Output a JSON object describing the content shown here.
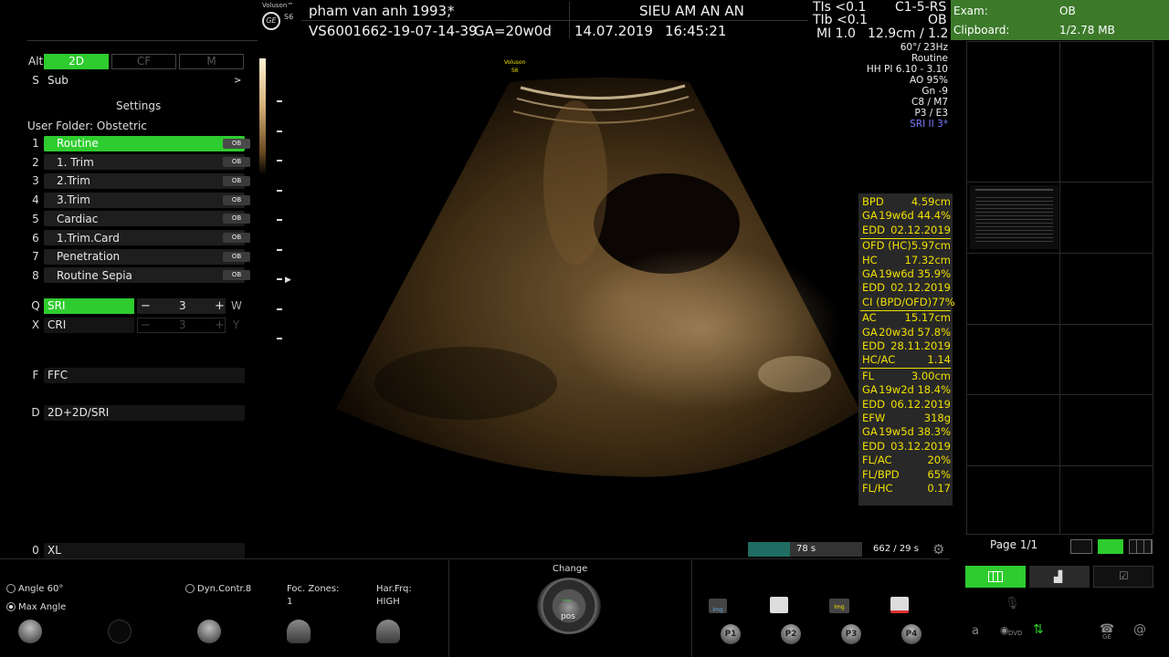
{
  "header": {
    "logo_brand": "Voluson™",
    "logo_model": "S6",
    "logo_maker": "GE",
    "patient": "pham van anh 1993,",
    "patient_flag": "*",
    "clinic": "SIEU AM AN AN",
    "exam_id": "VS6001662-19-07-14-39",
    "ga": "GA=20w0d",
    "date": "14.07.2019",
    "time": "16:45:21",
    "tis": "TIs <0.1",
    "tib": "TIb <0.1",
    "mi": "MI  1.0",
    "probe": "C1-5-RS",
    "preset": "OB",
    "depth": "12.9cm / 1.2"
  },
  "image_params": [
    "60°/ 23Hz",
    "Routine",
    "HH PI 6.10 - 3.10",
    "AO 95%",
    "Gn  -9",
    "C8 / M7",
    "P3 / E3",
    "SRI II 3*"
  ],
  "image_params_accent": "#7b7bff",
  "scan_watermark": {
    "brand": "Voluson",
    "model": "S6"
  },
  "right_bar": {
    "exam_label": "Exam:",
    "exam_value": "OB",
    "clipboard_label": "Clipboard:",
    "clipboard_value": "1/2.78 MB",
    "color": "#3c7a2a"
  },
  "left_panel": {
    "alt": "Alt",
    "mode_2d": "2D",
    "mode_cf": "CF",
    "mode_m": "M",
    "sub_key": "S",
    "sub": "Sub",
    "sub_arrow": ">",
    "settings": "Settings",
    "user_folder": "User Folder: Obstetric",
    "presets": [
      {
        "num": "1",
        "label": "Routine",
        "tag": "OB"
      },
      {
        "num": "2",
        "label": "1. Trim",
        "tag": "OB"
      },
      {
        "num": "3",
        "label": "2.Trim",
        "tag": "OB"
      },
      {
        "num": "4",
        "label": "3.Trim",
        "tag": "OB"
      },
      {
        "num": "5",
        "label": "Cardiac",
        "tag": "OB"
      },
      {
        "num": "6",
        "label": "1.Trim.Card",
        "tag": "OB"
      },
      {
        "num": "7",
        "label": "Penetration",
        "tag": "OB"
      },
      {
        "num": "8",
        "label": "Routine Sepia",
        "tag": "OB"
      }
    ],
    "sri_key": "Q",
    "sri": "SRI",
    "sri_value": "3",
    "sri_right_key": "W",
    "cri_key": "X",
    "cri": "CRI",
    "cri_value": "3",
    "cri_right_key": "Y",
    "ffc_key": "F",
    "ffc": "FFC",
    "dual_key": "D",
    "dual": "2D+2D/SRI",
    "xl_key": "0",
    "xl": "XL",
    "active_color": "#2ecc2e"
  },
  "measurements": [
    {
      "label": "BPD",
      "value": "4.59cm"
    },
    {
      "label": "GA",
      "value": "19w6d 44.4%"
    },
    {
      "label": "EDD",
      "value": "02.12.2019"
    },
    {
      "label": "OFD (HC)",
      "value": "5.97cm"
    },
    {
      "label": "HC",
      "value": "17.32cm"
    },
    {
      "label": "GA",
      "value": "19w6d 35.9%"
    },
    {
      "label": "EDD",
      "value": "02.12.2019"
    },
    {
      "label": "CI (BPD/OFD)",
      "value": "77%"
    },
    {
      "label": "AC",
      "value": "15.17cm"
    },
    {
      "label": "GA",
      "value": "20w3d 57.8%"
    },
    {
      "label": "EDD",
      "value": "28.11.2019"
    },
    {
      "label": "HC/AC",
      "value": "1.14"
    },
    {
      "label": "FL",
      "value": "3.00cm"
    },
    {
      "label": "GA",
      "value": "19w2d 18.4%"
    },
    {
      "label": "EDD",
      "value": "06.12.2019"
    },
    {
      "label": "EFW",
      "value": "318g"
    },
    {
      "label": "GA",
      "value": "19w5d 38.3%"
    },
    {
      "label": "EDD",
      "value": "03.12.2019"
    },
    {
      "label": "FL/AC",
      "value": "20%"
    },
    {
      "label": "FL/BPD",
      "value": "65%"
    },
    {
      "label": "FL/HC",
      "value": "0.17"
    }
  ],
  "measurement_color": "#f0e000",
  "cine": {
    "left": "78 s",
    "right": "662 / 29 s",
    "fill_fraction": 0.37
  },
  "page": "Page 1/1",
  "bottom": {
    "angle": "Angle 60°",
    "max_angle": "Max Angle",
    "dyn": "Dyn.Contr.8",
    "foc_label": "Foc. Zones:",
    "foc_value": "1",
    "har_label": "Har.Frq:",
    "har_value": "HIGH",
    "change": "Change",
    "pos": "pos",
    "img": "Img",
    "p1": "P1",
    "p2": "P2",
    "p3": "P3",
    "p4": "P4",
    "dvd": "DVD",
    "ge": "GE"
  }
}
